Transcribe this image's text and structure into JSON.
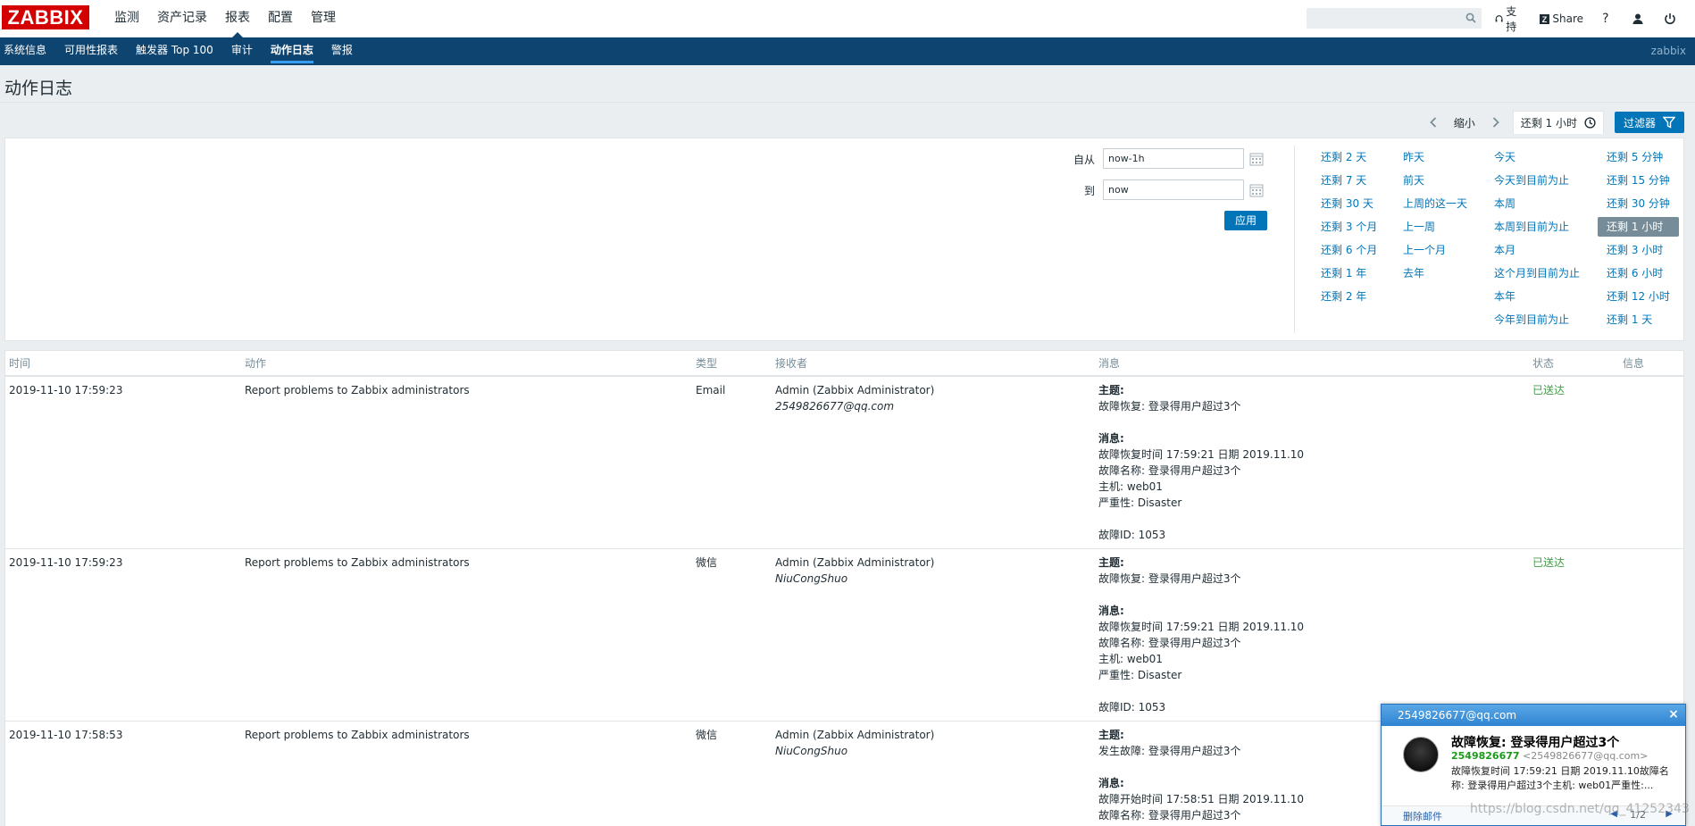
{
  "header": {
    "logo": "ZABBIX",
    "nav": [
      "监测",
      "资产记录",
      "报表",
      "配置",
      "管理"
    ],
    "active_nav": 2,
    "search_placeholder": "",
    "support": "支持",
    "share": "Share",
    "help": "?"
  },
  "subnav": {
    "items": [
      "系统信息",
      "可用性报表",
      "触发器 Top 100",
      "审计",
      "动作日志",
      "警报"
    ],
    "active": 4,
    "server": "zabbix"
  },
  "page": {
    "title": "动作日志"
  },
  "filterbar": {
    "zoom_out": "缩小",
    "time_tab": "还剩 1 小时",
    "filter_button": "过滤器"
  },
  "filter": {
    "from_label": "自从",
    "from_value": "now-1h",
    "to_label": "到",
    "to_value": "now",
    "apply": "应用",
    "quick": [
      [
        "还剩 2 天",
        "还剩 7 天",
        "还剩 30 天",
        "还剩 3 个月",
        "还剩 6 个月",
        "还剩 1 年",
        "还剩 2 年"
      ],
      [
        "昨天",
        "前天",
        "上周的这一天",
        "上一周",
        "上一个月",
        "去年"
      ],
      [
        "今天",
        "今天到目前为止",
        "本周",
        "本周到目前为止",
        "本月",
        "这个月到目前为止",
        "本年",
        "今年到目前为止"
      ],
      [
        "还剩 5 分钟",
        "还剩 15 分钟",
        "还剩 30 分钟",
        "还剩 1 小时",
        "还剩 3 小时",
        "还剩 6 小时",
        "还剩 12 小时",
        "还剩 1 天"
      ]
    ],
    "selected_quick": "还剩 1 小时"
  },
  "table": {
    "headers": [
      "时间",
      "动作",
      "类型",
      "接收者",
      "消息",
      "状态",
      "信息"
    ],
    "rows": [
      {
        "time": "2019-11-10 17:59:23",
        "action": "Report problems to Zabbix administrators",
        "type": "Email",
        "recipient": "Admin (Zabbix Administrator)",
        "recipient_to": "2549826677@qq.com",
        "subject_label": "主题:",
        "subject": "故障恢复: 登录得用户超过3个",
        "message_label": "消息:",
        "message": [
          "故障恢复时间 17:59:21 日期 2019.11.10",
          "故障名称: 登录得用户超过3个",
          "主机: web01",
          "严重性: Disaster",
          "",
          "故障ID: 1053"
        ],
        "status": "已送达",
        "info": ""
      },
      {
        "time": "2019-11-10 17:59:23",
        "action": "Report problems to Zabbix administrators",
        "type": "微信",
        "recipient": "Admin (Zabbix Administrator)",
        "recipient_to": "NiuCongShuo",
        "subject_label": "主题:",
        "subject": "故障恢复: 登录得用户超过3个",
        "message_label": "消息:",
        "message": [
          "故障恢复时间 17:59:21 日期 2019.11.10",
          "故障名称: 登录得用户超过3个",
          "主机: web01",
          "严重性: Disaster",
          "",
          "故障ID: 1053"
        ],
        "status": "已送达",
        "info": ""
      },
      {
        "time": "2019-11-10 17:58:53",
        "action": "Report problems to Zabbix administrators",
        "type": "微信",
        "recipient": "Admin (Zabbix Administrator)",
        "recipient_to": "NiuCongShuo",
        "subject_label": "主题:",
        "subject": "发生故障: 登录得用户超过3个",
        "message_label": "消息:",
        "message": [
          "故障开始时间 17:58:51 日期 2019.11.10",
          "故障名称: 登录得用户超过3个"
        ],
        "status": "",
        "info": ""
      }
    ]
  },
  "notification": {
    "account": "2549826677@qq.com",
    "title": "故障恢复: 登录得用户超过3个",
    "sender_name": "2549826677",
    "sender_addr": "<2549826677@qq.com>",
    "body": "故障恢复时间 17:59:21 日期 2019.11.10故障名称: 登录得用户超过3个主机: web01严重性:...",
    "delete": "删除邮件",
    "page": "1/2"
  },
  "watermark": "https://blog.csdn.net/qq_41252343"
}
